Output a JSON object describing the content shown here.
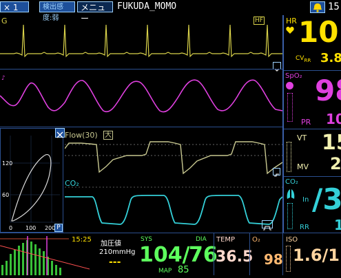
{
  "topbar": {
    "bed": "× 1",
    "sensitivity": "検出感度:弱",
    "menu": "メニュー",
    "patient": "FUKUDA_MOMO",
    "clock_partial": "15:"
  },
  "ecg": {
    "lead": "G",
    "hf": "HF"
  },
  "hr": {
    "label": "HR",
    "value": "10",
    "cv_label": "CV",
    "cv_sub": "RR",
    "cv_value": "3.8"
  },
  "spo2": {
    "label": "SpO₂",
    "value": "98",
    "pr_label": "PR",
    "pr_value": "10"
  },
  "flow_loop": {
    "y_ticks": [
      "120",
      "60"
    ],
    "x_ticks": [
      "0",
      "100",
      "200"
    ],
    "p_label": "P"
  },
  "flow": {
    "label": "Flow(30)",
    "size": "大"
  },
  "vent": {
    "vt_label": "VT",
    "vt_value": "15",
    "mv_label": "MV",
    "mv_value": "2"
  },
  "co2": {
    "wave_label": "CO₂",
    "label": "CO₂",
    "in_label": "In",
    "value": "/3",
    "rr_label": "RR",
    "rr_value": "1"
  },
  "trend": {
    "time": "15:25"
  },
  "nibp": {
    "title": "加圧値",
    "pressure": "210mmHg",
    "dashes": "---",
    "sys_label": "SYS",
    "dia_label": "DIA",
    "sys_value": "104/",
    "dia_value": "76",
    "map_label": "MAP",
    "map_value": "85"
  },
  "temp": {
    "label": "TEMP",
    "value": "36.5"
  },
  "o2": {
    "label": "O₂",
    "value": "98"
  },
  "iso": {
    "label": "ISO",
    "value": "1.6/1."
  },
  "colors": {
    "ecg": "#d9d24a",
    "spo2": "#e040e0",
    "flow": "#c8c890",
    "co2": "#34d0d8",
    "hr_value": "#ffe100",
    "vent": "#f2f0b0",
    "nibp": "#5dff5d",
    "temp": "#ffd8cc",
    "o2": "#ffb870",
    "iso": "#ffd5a0"
  }
}
